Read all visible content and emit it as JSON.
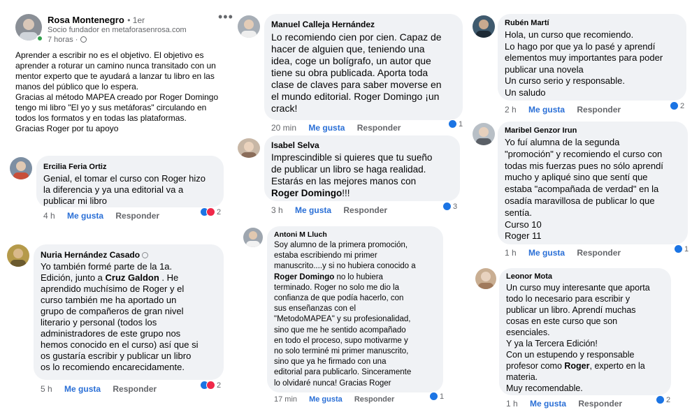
{
  "post": {
    "author": "Rosa Montenegro",
    "time_badge": "• 1er",
    "subtitle": "Socio fundador en metaforasenrosa.com",
    "time": "7 horas",
    "time_sep": "·",
    "body": "Aprender a escribir no es el objetivo. El objetivo es\naprender a roturar un camino nunca transitado con un\nmentor experto que te ayudará a lanzar tu libro en las\nmanos del público que lo espera.\nGracias al método MAPEA creado por Roger Domingo\ntengo mi libro \"El yo y sus metáforas\" circulando en\ntodos los formatos y en todas las plataformas.\nGracias Roger por tu apoyo",
    "more_icon": "more-options-icon"
  },
  "labels": {
    "like": "Me gusta",
    "reply": "Responder"
  },
  "colors": {
    "bubble": "#f0f2f5",
    "link": "#2a6fd6",
    "meta": "#65676b",
    "like_icon": "#1b74e4",
    "love_icon": "#f02849"
  },
  "comments": {
    "c1": {
      "name": "Ercilia Feria Ortiz",
      "text": "Genial, el tomar el curso con Roger hizo\nla diferencia y ya una editorial va a\npublicar mi libro",
      "time": "4 h",
      "count": "2"
    },
    "c2": {
      "name": "Nuria Hernández Casado",
      "text_a": "Yo también formé parte de la 1a.\nEdición, junto a ",
      "bold": "Cruz Galdon",
      "text_b": " . He\naprendido muchísimo de Roger y el\ncurso también me ha aportado un\ngrupo de compañeros de gran nivel\nliterario y personal (todos los\nadministradores de este grupo nos\nhemos conocido en el curso) así que si\nos gustaría escribir y publicar un libro\nos lo recomiendo encarecidamente.",
      "time": "5 h",
      "count": "2"
    },
    "c3": {
      "name": "Manuel Calleja Hernández",
      "text": "Lo recomiendo cien por cien. Capaz de\nhacer de alguien que, teniendo una\nidea, coge un bolígrafo, un autor que\ntiene su obra publicada. Aporta toda\nclase de claves para saber moverse en\nel mundo editorial. Roger Domingo ¡un\ncrack!",
      "time": "20 min",
      "count": "1"
    },
    "c4": {
      "name": "Isabel Selva",
      "text_a": "Imprescindible si quieres que tu sueño\nde publicar un libro se haga realidad.\nEstarás en las mejores manos con\n",
      "bold": "Roger Domingo",
      "text_b": "!!!",
      "time": "3 h",
      "count": "3"
    },
    "c5": {
      "name": "Antoni M Lluch",
      "text_a": "Soy alumno de la primera promoción,\nestaba escribiendo mi primer\nmanuscrito....y si no hubiera conocido a\n",
      "bold": "Roger Domingo",
      "text_b": " no lo hubiera\nterminado. Roger no solo me dio la\nconfianza de que podía hacerlo, con\nsus enseñanzas con el\n\"MetodoMAPEA\" y su profesionalidad,\nsino que me he sentido acompañado\nen todo el proceso, supo motivarme y\nno solo terminé mi primer manuscrito,\nsino que ya he firmado con una\neditorial para publicarlo. Sinceramente\nlo olvidaré nunca! Gracias Roger",
      "time": "17 min",
      "count": "1"
    },
    "c6": {
      "name": "Rubén Martí",
      "text": "Hola, un curso que recomiendo.\nLo hago por que ya lo pasé y aprendí\nelementos muy importantes para poder\npublicar una novela\nUn curso serio y responsable.\nUn saludo",
      "time": "2 h",
      "count": "2"
    },
    "c7": {
      "name": "Maribel Genzor Irun",
      "text": "Yo fuí alumna de la segunda\n\"promoción\" y recomiendo el curso con\ntodas mis fuerzas pues no sólo aprendí\nmucho y apliqué sino que sentí que\nestaba \"acompañada de verdad\" en la\nosadía maravillosa de publicar lo que\nsentía.\nCurso 10\nRoger 11",
      "time": "1 h",
      "count": "1"
    },
    "c8": {
      "name": "Leonor Mota",
      "text_a": "Un curso muy interesante que aporta\ntodo lo necesario para escribir y\npublicar un libro. Aprendí muchas\ncosas en este curso que son\nesenciales.\nY ya la Tercera Edición!\nCon un estupendo y responsable\nprofesor como ",
      "bold": "Roger",
      "text_b": ", experto en la\nmateria.\nMuy recomendable.",
      "time": "1 h",
      "count": "2"
    }
  }
}
